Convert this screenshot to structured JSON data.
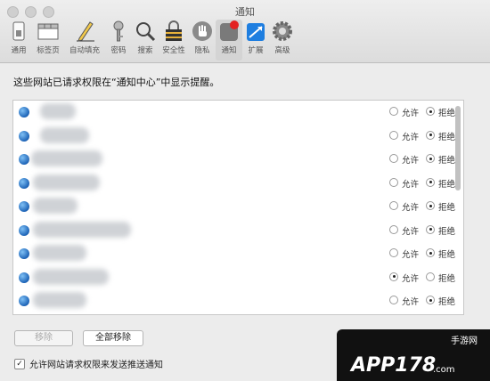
{
  "window": {
    "title": "通知"
  },
  "toolbar": {
    "items": [
      {
        "label": "通用",
        "icon": "switch-icon"
      },
      {
        "label": "标签页",
        "icon": "tabs-icon"
      },
      {
        "label": "自动填充",
        "icon": "pencil-icon"
      },
      {
        "label": "密码",
        "icon": "key-icon"
      },
      {
        "label": "搜索",
        "icon": "magnifier-icon"
      },
      {
        "label": "安全性",
        "icon": "lock-icon"
      },
      {
        "label": "隐私",
        "icon": "hand-icon"
      },
      {
        "label": "通知",
        "icon": "notification-icon"
      },
      {
        "label": "扩展",
        "icon": "puzzle-icon"
      },
      {
        "label": "高级",
        "icon": "gear-icon"
      }
    ],
    "active_index": 7
  },
  "heading": "这些网站已请求权限在“通知中心”中显示提醒。",
  "sites": {
    "allow_label": "允许",
    "deny_label": "拒绝",
    "rows": [
      {
        "selected": "deny"
      },
      {
        "selected": "deny"
      },
      {
        "selected": "deny"
      },
      {
        "selected": "deny"
      },
      {
        "selected": "deny"
      },
      {
        "selected": "deny"
      },
      {
        "selected": "deny"
      },
      {
        "selected": "allow"
      },
      {
        "selected": "deny"
      }
    ]
  },
  "buttons": {
    "remove": "移除",
    "remove_all": "全部移除"
  },
  "checkbox": {
    "label": "允许网站请求权限来发送推送通知",
    "checked": true,
    "mark": "✓"
  },
  "watermark": {
    "text": "APP178",
    "sub": "手游网",
    "domain": ".com"
  }
}
